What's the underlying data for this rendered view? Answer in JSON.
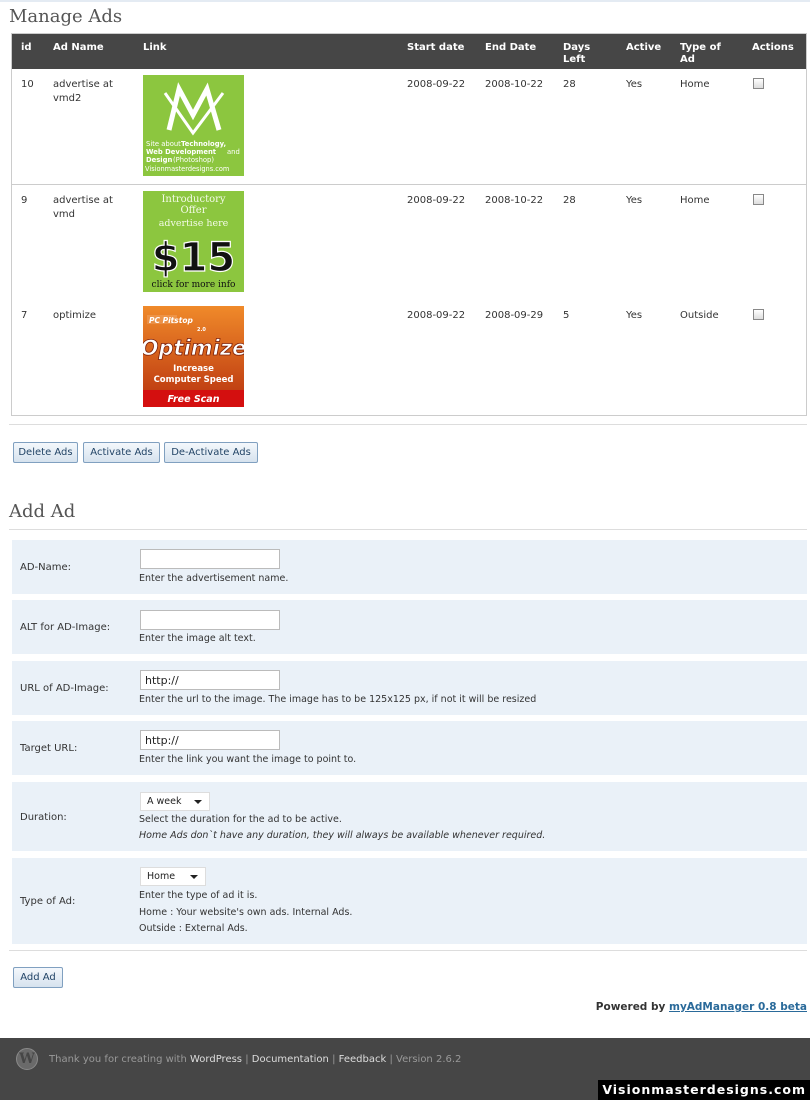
{
  "manage": {
    "title": "Manage Ads",
    "columns": {
      "id": "id",
      "name": "Ad Name",
      "link": "Link",
      "start": "Start date",
      "end": "End Date",
      "days": [
        "Days",
        "Left"
      ],
      "active": "Active",
      "type": [
        "Type of",
        "Ad"
      ],
      "actions": "Actions"
    },
    "rows": [
      {
        "id": "10",
        "name": [
          "advertise at",
          "vmd2"
        ],
        "start": "2008-09-22",
        "end": "2008-10-22",
        "days": "28",
        "active": "Yes",
        "type": "Home",
        "image": {
          "site_about": "Site about",
          "technology": "Technology,",
          "web_dev": "Web Development",
          "and": "and",
          "design": "Design",
          "photoshop": "(Photoshop)",
          "domain": "Visionmasterdesigns.com"
        }
      },
      {
        "id": "9",
        "name": [
          "advertise at",
          "vmd"
        ],
        "start": "2008-09-22",
        "end": "2008-10-22",
        "days": "28",
        "active": "Yes",
        "type": "Home",
        "image": {
          "line1": "Introductory",
          "line2": "Offer",
          "line3": "advertise here",
          "price": "$15",
          "line4": "click for more info"
        }
      },
      {
        "id": "7",
        "name": [
          "optimize"
        ],
        "start": "2008-09-22",
        "end": "2008-09-29",
        "days": "5",
        "active": "Yes",
        "type": "Outside",
        "image": {
          "brand": "PC Pitstop",
          "version": "2.0",
          "headline": "Optimize",
          "sub1": "Increase",
          "sub2": "Computer Speed",
          "cta": "Free Scan"
        }
      }
    ],
    "buttons": {
      "delete": "Delete Ads",
      "activate": "Activate Ads",
      "deactivate": "De-Activate Ads"
    }
  },
  "add": {
    "title": "Add Ad",
    "fields": {
      "name": {
        "label": "AD-Name:",
        "value": "",
        "help": "Enter the advertisement name."
      },
      "alt": {
        "label": "ALT for AD-Image:",
        "value": "",
        "help": "Enter the image alt text."
      },
      "url": {
        "label": "URL of AD-Image:",
        "value": "http://",
        "help": "Enter the url to the image. The image has to be 125x125 px, if not it will be resized"
      },
      "target": {
        "label": "Target URL:",
        "value": "http://",
        "help": "Enter the link you want the image to point to."
      },
      "duration": {
        "label": "Duration:",
        "selected": "A week",
        "help": "Select the duration for the ad to be active.",
        "note": "Home Ads don`t have any duration, they will always be available whenever required."
      },
      "type": {
        "label": "Type of Ad:",
        "selected": "Home",
        "help1": "Enter the type of ad it is.",
        "help2": "Home : Your website's own ads. Internal Ads.",
        "help3": "Outside : External Ads."
      }
    },
    "submit": "Add Ad"
  },
  "powered": {
    "prefix": "Powered by",
    "link": "myAdManager 0.8 beta"
  },
  "footer": {
    "thanks": "Thank you for creating with",
    "wordpress": "WordPress",
    "sep": "|",
    "documentation": "Documentation",
    "feedback": "Feedback",
    "version": "Version 2.6.2"
  },
  "watermark": "Visionmasterdesigns.com",
  "colors": {
    "header_bg": "#464646",
    "form_row_bg": "#eaf1f8",
    "link": "#2a6a9a",
    "green_ad": "#8cc63f",
    "orange_ad": "#e0701c"
  }
}
